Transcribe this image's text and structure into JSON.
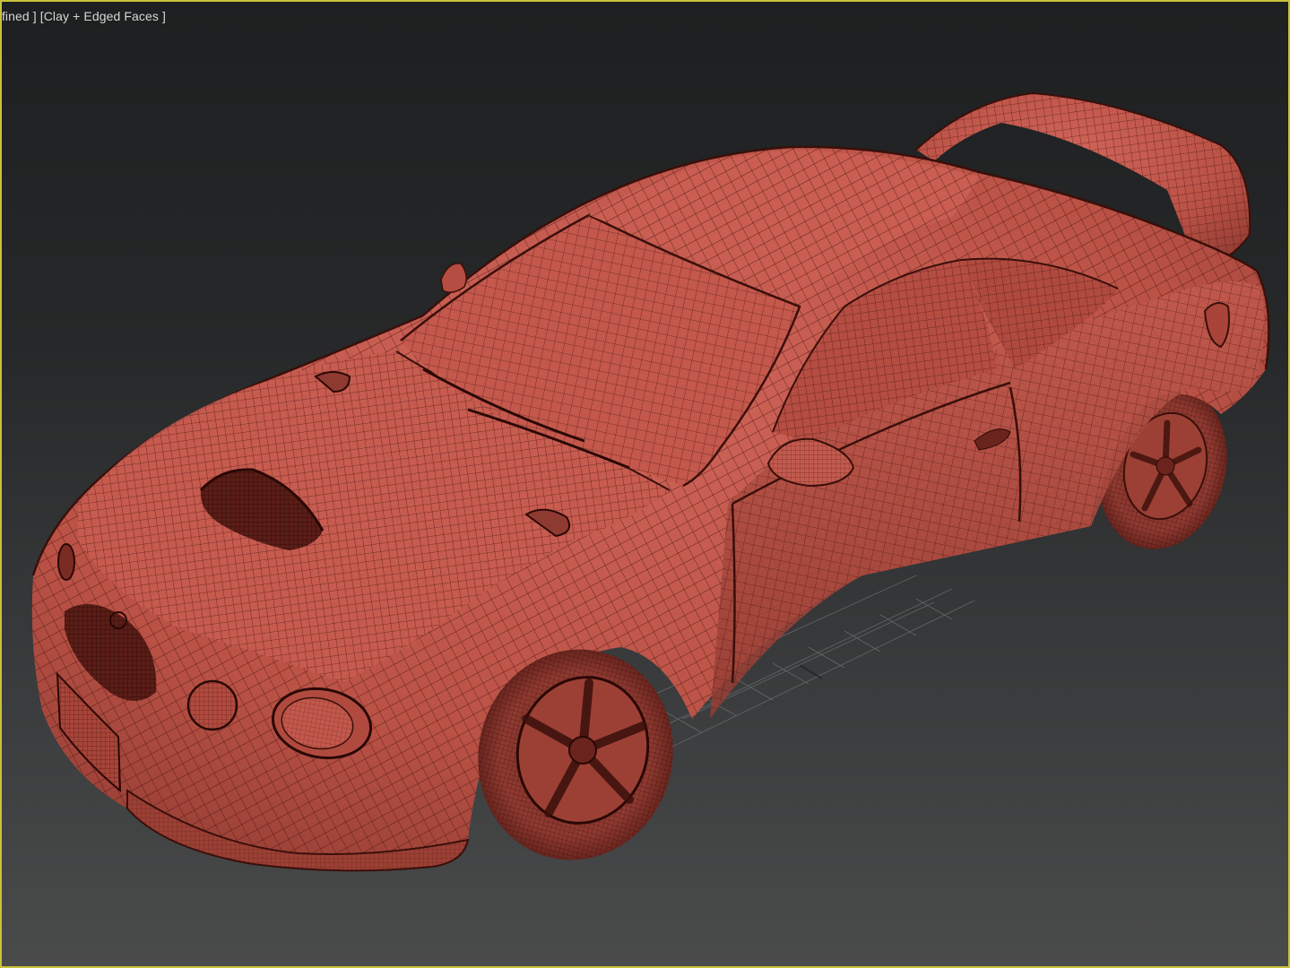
{
  "viewport": {
    "label_segments": [
      "efined ]",
      " [Clay + Edged Faces ]"
    ],
    "border_color": "#c8c23a",
    "background_top": "#1d1f20",
    "background_bottom": "#4a4b4b"
  },
  "model": {
    "shading": "Clay + Edged Faces",
    "clay_color": "#c0564a",
    "edge_color": "#4a1510"
  }
}
